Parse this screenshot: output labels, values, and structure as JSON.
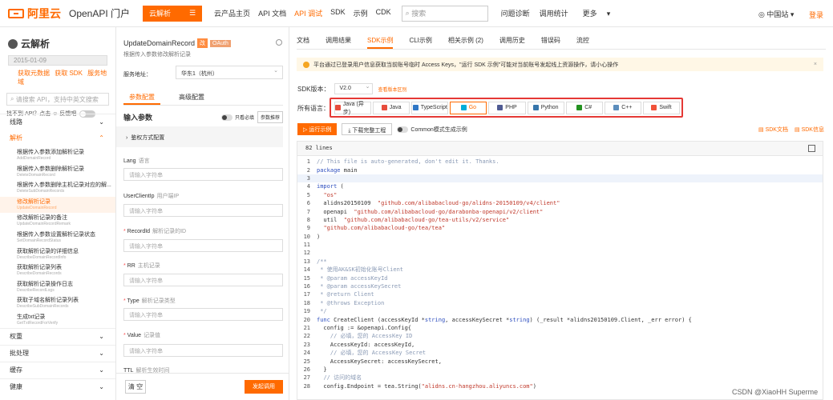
{
  "topbar": {
    "logo": "阿里云",
    "portal": "OpenAPI 门户",
    "cloud_btn": "云解析",
    "nav": [
      "云产品主页",
      "API 文档",
      "API 调试",
      "SDK",
      "示例",
      "CDK"
    ],
    "active_nav": 2,
    "search_placeholder": "搜索",
    "right_links": [
      "问题诊断",
      "调用统计",
      "更多"
    ],
    "region": "中国站",
    "login": "登录"
  },
  "left": {
    "title": "云解析",
    "date": "2015-01-09",
    "quick": [
      "获取元数据",
      "获取 SDK",
      "服务地域"
    ],
    "search_placeholder": "请搜索 API，支持中英文搜索",
    "note": "找不到 API？点击",
    "note2": "反馈吧",
    "groups": [
      "线路",
      "解析",
      "权重",
      "批处理",
      "缓存",
      "健康"
    ],
    "items": [
      {
        "t": "根据传入参数添加解析记录",
        "s": "AddDomainRecord"
      },
      {
        "t": "根据传入参数删除解析记录",
        "s": "DeleteDomainRecord"
      },
      {
        "t": "根据传入参数删除主机记录对应的解...",
        "s": "DeleteSubDomainRecords"
      },
      {
        "t": "修改解析记录",
        "s": "UpdateDomainRecord"
      },
      {
        "t": "修改解析记录的备注",
        "s": "UpdateDomainRecordRemark"
      },
      {
        "t": "根据传入参数设置解析记录状态",
        "s": "SetDomainRecordStatus"
      },
      {
        "t": "获取解析记录的详细信息",
        "s": "DescribeDomainRecordInfo"
      },
      {
        "t": "获取解析记录列表",
        "s": "DescribeDomainRecords"
      },
      {
        "t": "获取解析记录操作日志",
        "s": "DescribeRecordLogs"
      },
      {
        "t": "获取子域名解析记录列表",
        "s": "DescribeSubDomainRecords"
      },
      {
        "t": "生成txt记录",
        "s": "GetTxtRecordForVerify"
      }
    ]
  },
  "mid": {
    "api": "UpdateDomainRecord",
    "tag1": "改",
    "tag2": "OAuth",
    "sub": "根据传入参数修改解析记录",
    "service_label": "服务地址：",
    "service": "华东1（杭州）",
    "tabs": [
      "参数配置",
      "高级配置"
    ],
    "input_title": "输入参数",
    "required_only": "只看必填",
    "recommend": "参数推荐",
    "auth": "鉴权方式配置",
    "fields": [
      {
        "star": "",
        "name": "Lang",
        "sub": "语言"
      },
      {
        "star": "",
        "name": "UserClientIp",
        "sub": "用户端IP"
      },
      {
        "star": "* ",
        "name": "RecordId",
        "sub": "解析记录的ID"
      },
      {
        "star": "* ",
        "name": "RR",
        "sub": "主机记录"
      },
      {
        "star": "* ",
        "name": "Type",
        "sub": "解析记录类型"
      },
      {
        "star": "* ",
        "name": "Value",
        "sub": "记录值"
      },
      {
        "star": "",
        "name": "TTL",
        "sub": "解析生效时间"
      }
    ],
    "input_placeholder": "请输入字符串",
    "clear": "清 空",
    "send": "发起调用"
  },
  "right": {
    "tabs": [
      "文档",
      "调用结果",
      "SDK示例",
      "CLI示例",
      "相关示例 (2)",
      "调用历史",
      "错误码",
      "流控"
    ],
    "active_tab": 2,
    "alert": "平台通过已登录用户信息获取当前账号临时 Access Keys，\"运行 SDK 示例\"可能对当前账号发起线上资源操作，请小心操作",
    "sdk_label": "SDK版本：",
    "sdk_version": "V2.0",
    "version_link": "查看版本区别",
    "lang_label": "所有语言：",
    "languages": [
      {
        "name": "Java (异步)",
        "color": "#e74c3c"
      },
      {
        "name": "Java",
        "color": "#e74c3c"
      },
      {
        "name": "TypeScript",
        "color": "#3178c6"
      },
      {
        "name": "Go",
        "color": "#00add8"
      },
      {
        "name": "PHP",
        "color": "#4f5b93"
      },
      {
        "name": "Python",
        "color": "#3776ab"
      },
      {
        "name": "C#",
        "color": "#239120"
      },
      {
        "name": "C++",
        "color": "#5c8dbc"
      },
      {
        "name": "Swift",
        "color": "#f05138"
      }
    ],
    "active_lang": 3,
    "run": "▷ 运行示例",
    "download": "下载完整工程",
    "common_mode": "Common模式生成示例",
    "sdk_doc": "SDK文档",
    "sdk_info": "SDK信息",
    "lines_count": "82 lines"
  },
  "watermark": "CSDN @XiaoHH Superme"
}
